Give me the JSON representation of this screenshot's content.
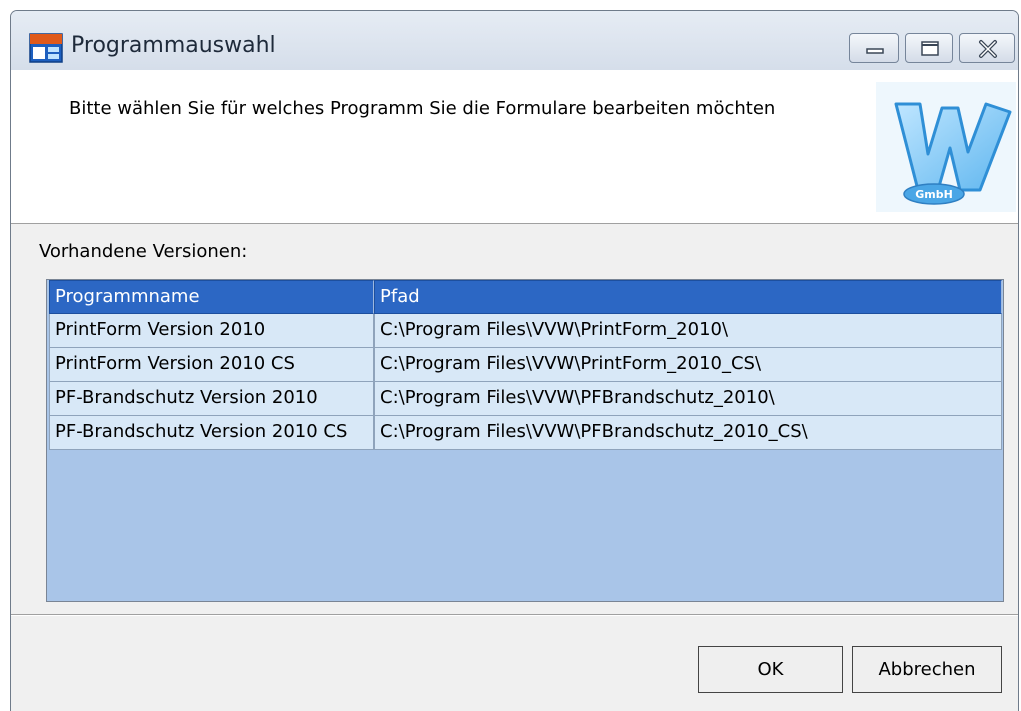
{
  "window": {
    "title": "Programmauswahl",
    "app_icon": "app-window-icon"
  },
  "window_controls": {
    "minimize_icon": "minimize-icon",
    "maximize_icon": "maximize-icon",
    "close_icon": "close-icon"
  },
  "header": {
    "instruction": "Bitte wählen Sie für welches Programm Sie die Formulare bearbeiten möchten",
    "logo": "vvw-gmbh-logo",
    "logo_text": "GmbH"
  },
  "versions": {
    "label": "Vorhandene Versionen:",
    "columns": [
      "Programmname",
      "Pfad"
    ],
    "rows": [
      {
        "name": "PrintForm Version 2010",
        "path": "C:\\Program Files\\VVW\\PrintForm_2010\\"
      },
      {
        "name": "PrintForm Version 2010 CS",
        "path": "C:\\Program Files\\VVW\\PrintForm_2010_CS\\"
      },
      {
        "name": "PF-Brandschutz Version 2010",
        "path": "C:\\Program Files\\VVW\\PFBrandschutz_2010\\"
      },
      {
        "name": "PF-Brandschutz Version 2010 CS",
        "path": "C:\\Program Files\\VVW\\PFBrandschutz_2010_CS\\"
      }
    ]
  },
  "buttons": {
    "ok": "OK",
    "cancel": "Abbrechen"
  },
  "colors": {
    "header_row": "#2c67c4",
    "row_background": "#d8e8f7",
    "grid_background": "#a9c5e8"
  }
}
